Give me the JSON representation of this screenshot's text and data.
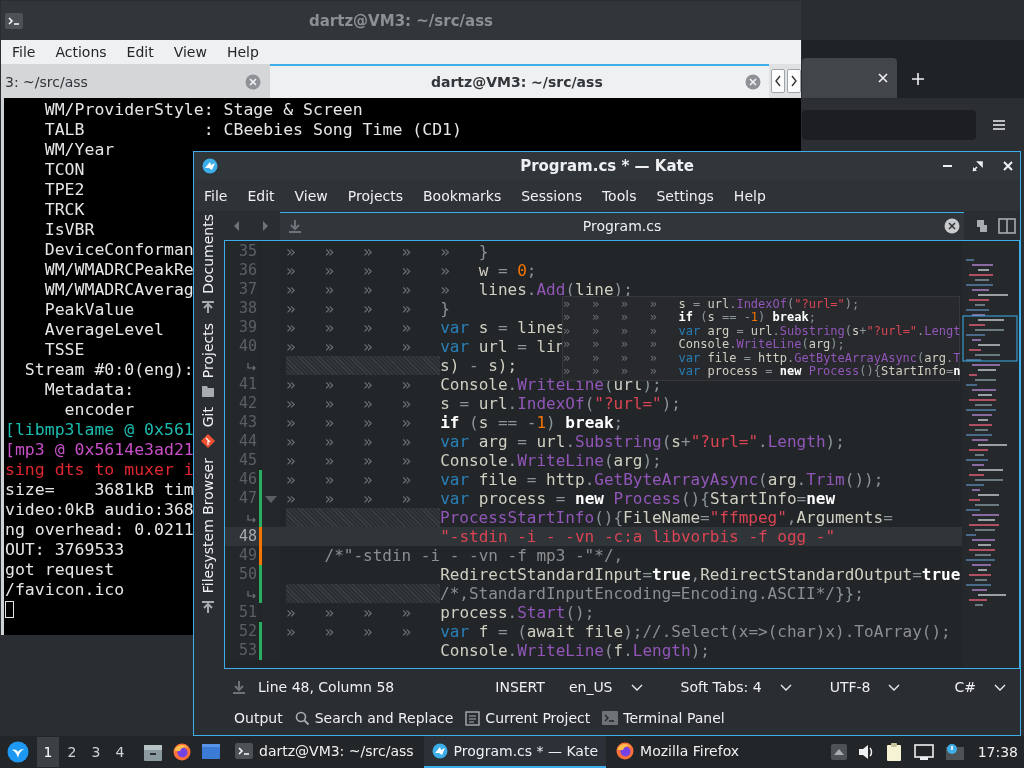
{
  "terminal_window": {
    "title": "dartz@VM3: ~/src/ass",
    "menu": [
      "File",
      "Actions",
      "Edit",
      "View",
      "Help"
    ],
    "tabs": [
      {
        "label": "3: ~/src/ass",
        "selected": false
      },
      {
        "label": "dartz@VM3: ~/src/ass",
        "selected": true
      }
    ],
    "lines": [
      {
        "text": "    WM/ProviderStyle: Stage & Screen",
        "color": "#e6e6e6"
      },
      {
        "text": "    TALB            : CBeebies Song Time (CD1)",
        "color": "#e6e6e6"
      },
      {
        "text": "    WM/Year",
        "color": "#e6e6e6"
      },
      {
        "text": "    TCON",
        "color": "#e6e6e6"
      },
      {
        "text": "    TPE2",
        "color": "#e6e6e6"
      },
      {
        "text": "    TRCK",
        "color": "#e6e6e6"
      },
      {
        "text": "    IsVBR",
        "color": "#e6e6e6"
      },
      {
        "text": "    DeviceConforman",
        "color": "#e6e6e6"
      },
      {
        "text": "    WM/WMADRCPeakRe",
        "color": "#e6e6e6"
      },
      {
        "text": "    WM/WMADRCAverag",
        "color": "#e6e6e6"
      },
      {
        "text": "    PeakValue",
        "color": "#e6e6e6"
      },
      {
        "text": "    AverageLevel",
        "color": "#e6e6e6"
      },
      {
        "text": "    TSSE",
        "color": "#e6e6e6"
      },
      {
        "text": "  Stream #0:0(eng):",
        "color": "#e6e6e6"
      },
      {
        "text": "    Metadata:",
        "color": "#e6e6e6"
      },
      {
        "text": "      encoder",
        "color": "#e6e6e6"
      },
      {
        "text": "[libmp3lame @ 0x561",
        "color": "#1abcb0"
      },
      {
        "text": "[mp3 @ 0x5614e3ad21",
        "color": "#c94fc9"
      },
      {
        "text": "sing dts to muxer i",
        "color": "#e0262f"
      },
      {
        "text": "size=    3681kB tim",
        "color": "#e6e6e6"
      },
      {
        "text": "video:0kB audio:368",
        "color": "#e6e6e6"
      },
      {
        "text": "ng overhead: 0.0211",
        "color": "#e6e6e6"
      },
      {
        "text": "OUT: 3769533",
        "color": "#e6e6e6"
      },
      {
        "text": "got request",
        "color": "#e6e6e6"
      },
      {
        "text": "/favicon.ico",
        "color": "#e6e6e6"
      }
    ],
    "cursor": true
  },
  "editor_window": {
    "title": "Program.cs * — Kate",
    "menu": [
      "File",
      "Edit",
      "View",
      "Projects",
      "Bookmarks",
      "Sessions",
      "Tools",
      "Settings",
      "Help"
    ],
    "sidebar_tabs": [
      "Documents",
      "Projects",
      "Git",
      "Filesystem Browser"
    ],
    "document_tab": {
      "label": "Program.cs"
    },
    "code_lines": [
      {
        "kind": "line",
        "number": "35",
        "current": false,
        "fold": false,
        "tokens": [
          {
            "kind": "indent",
            "text": "»»»»»"
          },
          {
            "kind": "op",
            "text": "}"
          }
        ]
      },
      {
        "kind": "line",
        "number": "36",
        "current": false,
        "fold": false,
        "tokens": [
          {
            "kind": "indent",
            "text": "»»»»»"
          },
          {
            "kind": "plain",
            "text": "w "
          },
          {
            "kind": "op",
            "text": "= "
          },
          {
            "kind": "num",
            "text": "0"
          },
          {
            "kind": "op",
            "text": ";"
          }
        ]
      },
      {
        "kind": "line",
        "number": "37",
        "current": false,
        "fold": false,
        "tokens": [
          {
            "kind": "indent",
            "text": "»»»»»"
          },
          {
            "kind": "plain",
            "text": "lines"
          },
          {
            "kind": "op",
            "text": "."
          },
          {
            "kind": "fn",
            "text": "Add"
          },
          {
            "kind": "op",
            "text": "("
          },
          {
            "kind": "plain",
            "text": "line"
          },
          {
            "kind": "op",
            "text": ");"
          }
        ]
      },
      {
        "kind": "line",
        "number": "38",
        "current": false,
        "fold": false,
        "tokens": [
          {
            "kind": "indent",
            "text": "»»»»"
          },
          {
            "kind": "op",
            "text": "}"
          }
        ]
      },
      {
        "kind": "line",
        "number": "39",
        "current": false,
        "fold": false,
        "tokens": [
          {
            "kind": "indent",
            "text": "»»»»"
          },
          {
            "kind": "kw",
            "text": "var"
          },
          {
            "kind": "plain",
            "text": " s "
          },
          {
            "kind": "op",
            "text": "= "
          },
          {
            "kind": "plain",
            "text": "lines"
          }
        ]
      },
      {
        "kind": "line",
        "number": "40",
        "current": false,
        "fold": false,
        "tokens": [
          {
            "kind": "indent",
            "text": "»»»»"
          },
          {
            "kind": "kw",
            "text": "var"
          },
          {
            "kind": "plain",
            "text": " url "
          },
          {
            "kind": "op",
            "text": "= "
          },
          {
            "kind": "plain",
            "text": "lin"
          }
        ]
      },
      {
        "kind": "wrap",
        "current": false,
        "fold": false,
        "tokens": [
          {
            "kind": "plain",
            "text": "s) "
          },
          {
            "kind": "op",
            "text": "- "
          },
          {
            "kind": "plain",
            "text": "s);"
          }
        ]
      },
      {
        "kind": "line",
        "number": "41",
        "current": false,
        "fold": false,
        "tokens": [
          {
            "kind": "indent",
            "text": "»»»»"
          },
          {
            "kind": "plain",
            "text": "Console"
          },
          {
            "kind": "op",
            "text": "."
          },
          {
            "kind": "fn",
            "text": "WriteLine"
          },
          {
            "kind": "op",
            "text": "("
          },
          {
            "kind": "plain",
            "text": "url"
          },
          {
            "kind": "op",
            "text": ");"
          }
        ]
      },
      {
        "kind": "line",
        "number": "42",
        "current": false,
        "fold": false,
        "tokens": [
          {
            "kind": "indent",
            "text": "»»»»"
          },
          {
            "kind": "plain",
            "text": "s "
          },
          {
            "kind": "op",
            "text": "= "
          },
          {
            "kind": "plain",
            "text": "url"
          },
          {
            "kind": "op",
            "text": "."
          },
          {
            "kind": "fn",
            "text": "IndexOf"
          },
          {
            "kind": "op",
            "text": "("
          },
          {
            "kind": "str",
            "text": "\"?url=\""
          },
          {
            "kind": "op",
            "text": ");"
          }
        ]
      },
      {
        "kind": "line",
        "number": "43",
        "current": false,
        "fold": false,
        "tokens": [
          {
            "kind": "indent",
            "text": "»»»»"
          },
          {
            "kind": "ctl",
            "text": "if"
          },
          {
            "kind": "op",
            "text": " ("
          },
          {
            "kind": "plain",
            "text": "s "
          },
          {
            "kind": "op",
            "text": "== -"
          },
          {
            "kind": "num",
            "text": "1"
          },
          {
            "kind": "op",
            "text": ") "
          },
          {
            "kind": "ctl",
            "text": "break"
          },
          {
            "kind": "op",
            "text": ";"
          }
        ]
      },
      {
        "kind": "line",
        "number": "44",
        "current": false,
        "fold": false,
        "tokens": [
          {
            "kind": "indent",
            "text": "»»»»"
          },
          {
            "kind": "kw",
            "text": "var"
          },
          {
            "kind": "plain",
            "text": " arg "
          },
          {
            "kind": "op",
            "text": "= "
          },
          {
            "kind": "plain",
            "text": "url"
          },
          {
            "kind": "op",
            "text": "."
          },
          {
            "kind": "fn",
            "text": "Substring"
          },
          {
            "kind": "op",
            "text": "("
          },
          {
            "kind": "plain",
            "text": "s"
          },
          {
            "kind": "op",
            "text": "+"
          },
          {
            "kind": "str",
            "text": "\"?url=\""
          },
          {
            "kind": "op",
            "text": "."
          },
          {
            "kind": "fn",
            "text": "Length"
          },
          {
            "kind": "op",
            "text": ");"
          }
        ]
      },
      {
        "kind": "line",
        "number": "45",
        "current": false,
        "fold": false,
        "tokens": [
          {
            "kind": "indent",
            "text": "»»»»"
          },
          {
            "kind": "plain",
            "text": "Console"
          },
          {
            "kind": "op",
            "text": "."
          },
          {
            "kind": "fn",
            "text": "WriteLine"
          },
          {
            "kind": "op",
            "text": "("
          },
          {
            "kind": "plain",
            "text": "arg"
          },
          {
            "kind": "op",
            "text": ");"
          }
        ]
      },
      {
        "kind": "line",
        "number": "46",
        "current": false,
        "fold": false,
        "color": "#27ae60",
        "tokens": [
          {
            "kind": "indent",
            "text": "»»»»"
          },
          {
            "kind": "kw",
            "text": "var"
          },
          {
            "kind": "plain",
            "text": " file "
          },
          {
            "kind": "op",
            "text": "= "
          },
          {
            "kind": "plain",
            "text": "http"
          },
          {
            "kind": "op",
            "text": "."
          },
          {
            "kind": "fn",
            "text": "GetByteArrayAsync"
          },
          {
            "kind": "op",
            "text": "("
          },
          {
            "kind": "plain",
            "text": "arg"
          },
          {
            "kind": "op",
            "text": "."
          },
          {
            "kind": "fn",
            "text": "Trim"
          },
          {
            "kind": "op",
            "text": "());"
          }
        ]
      },
      {
        "kind": "line",
        "number": "47",
        "current": false,
        "fold": true,
        "color": "#27ae60",
        "tokens": [
          {
            "kind": "indent",
            "text": "»»»»"
          },
          {
            "kind": "kw",
            "text": "var"
          },
          {
            "kind": "plain",
            "text": " process "
          },
          {
            "kind": "op",
            "text": "= "
          },
          {
            "kind": "ctl",
            "text": "new "
          },
          {
            "kind": "fn",
            "text": "Process"
          },
          {
            "kind": "op",
            "text": "(){"
          },
          {
            "kind": "plain",
            "text": "StartInfo"
          },
          {
            "kind": "op",
            "text": "="
          },
          {
            "kind": "ctl",
            "text": "new"
          }
        ]
      },
      {
        "kind": "wrap",
        "current": false,
        "fold": false,
        "color": "#27ae60",
        "tokens": [
          {
            "kind": "fn",
            "text": "ProcessStartInfo"
          },
          {
            "kind": "op",
            "text": "(){"
          },
          {
            "kind": "plain",
            "text": "FileName"
          },
          {
            "kind": "op",
            "text": "="
          },
          {
            "kind": "str",
            "text": "\"ffmpeg\""
          },
          {
            "kind": "op",
            "text": ","
          },
          {
            "kind": "plain",
            "text": "Arguments"
          },
          {
            "kind": "op",
            "text": "="
          }
        ]
      },
      {
        "kind": "line",
        "number": "48",
        "current": true,
        "fold": false,
        "color": "#f67400",
        "tokens": [
          {
            "kind": "str",
            "text": "                \"-stdin -i - -vn -c:a libvorbis -f ogg -\""
          }
        ]
      },
      {
        "kind": "line",
        "number": "49",
        "current": false,
        "fold": false,
        "color": "#f67400",
        "tokens": [
          {
            "kind": "cmt",
            "text": "    /*\"-stdin -i - -vn -f mp3 -\"*/,"
          }
        ]
      },
      {
        "kind": "line",
        "number": "50",
        "current": false,
        "fold": false,
        "color": "#27ae60",
        "tokens": [
          {
            "kind": "plain",
            "text": "                RedirectStandardInput"
          },
          {
            "kind": "op",
            "text": "="
          },
          {
            "kind": "ctl",
            "text": "true"
          },
          {
            "kind": "op",
            "text": ","
          },
          {
            "kind": "plain",
            "text": "RedirectStandardOutput"
          },
          {
            "kind": "op",
            "text": "="
          },
          {
            "kind": "ctl",
            "text": "true"
          }
        ]
      },
      {
        "kind": "wrap",
        "current": false,
        "fold": false,
        "color": "#27ae60",
        "tokens": [
          {
            "kind": "cmt",
            "text": "/*,StandardInputEncoding=Encoding.ASCII*/"
          },
          {
            "kind": "op",
            "text": "}};"
          }
        ]
      },
      {
        "kind": "line",
        "number": "51",
        "current": false,
        "fold": false,
        "tokens": [
          {
            "kind": "indent",
            "text": "»»»»"
          },
          {
            "kind": "plain",
            "text": "process"
          },
          {
            "kind": "op",
            "text": "."
          },
          {
            "kind": "fn",
            "text": "Start"
          },
          {
            "kind": "op",
            "text": "();"
          }
        ]
      },
      {
        "kind": "line",
        "number": "52",
        "current": false,
        "fold": false,
        "color": "#27ae60",
        "tokens": [
          {
            "kind": "indent",
            "text": "»»»»"
          },
          {
            "kind": "kw",
            "text": "var"
          },
          {
            "kind": "plain",
            "text": " f "
          },
          {
            "kind": "op",
            "text": "= ("
          },
          {
            "kind": "plain",
            "text": "await file"
          },
          {
            "kind": "op",
            "text": ");"
          },
          {
            "kind": "cmt",
            "text": "//.Select(x=>(char)x).ToArray();"
          }
        ]
      },
      {
        "kind": "line",
        "number": "53",
        "current": false,
        "fold": false,
        "color": "#27ae60",
        "tokens": [
          {
            "kind": "plain",
            "text": "                Console"
          },
          {
            "kind": "op",
            "text": "."
          },
          {
            "kind": "fn",
            "text": "WriteLine"
          },
          {
            "kind": "op",
            "text": "("
          },
          {
            "kind": "plain",
            "text": "f"
          },
          {
            "kind": "op",
            "text": "."
          },
          {
            "kind": "fn",
            "text": "Length"
          },
          {
            "kind": "op",
            "text": ");"
          }
        ]
      }
    ],
    "scroll_preview": [
      {
        "tokens": [
          {
            "kind": "indent",
            "text": "»»»»"
          },
          {
            "kind": "plain",
            "text": "s "
          },
          {
            "kind": "op",
            "text": "= "
          },
          {
            "kind": "plain",
            "text": "url"
          },
          {
            "kind": "op",
            "text": "."
          },
          {
            "kind": "fn",
            "text": "IndexOf"
          },
          {
            "kind": "op",
            "text": "("
          },
          {
            "kind": "str",
            "text": "\"?url=\""
          },
          {
            "kind": "op",
            "text": ");"
          }
        ]
      },
      {
        "tokens": [
          {
            "kind": "indent",
            "text": "»»»»"
          },
          {
            "kind": "ctl",
            "text": "if"
          },
          {
            "kind": "op",
            "text": " ("
          },
          {
            "kind": "plain",
            "text": "s "
          },
          {
            "kind": "op",
            "text": "== -"
          },
          {
            "kind": "num",
            "text": "1"
          },
          {
            "kind": "op",
            "text": ") "
          },
          {
            "kind": "ctl",
            "text": "break"
          },
          {
            "kind": "op",
            "text": ";"
          }
        ]
      },
      {
        "tokens": [
          {
            "kind": "indent",
            "text": "»»»»"
          },
          {
            "kind": "kw",
            "text": "var"
          },
          {
            "kind": "plain",
            "text": " arg "
          },
          {
            "kind": "op",
            "text": "= "
          },
          {
            "kind": "plain",
            "text": "url"
          },
          {
            "kind": "op",
            "text": "."
          },
          {
            "kind": "fn",
            "text": "Substring"
          },
          {
            "kind": "op",
            "text": "("
          },
          {
            "kind": "plain",
            "text": "s"
          },
          {
            "kind": "op",
            "text": "+"
          },
          {
            "kind": "str",
            "text": "\"?url=\""
          },
          {
            "kind": "op",
            "text": "."
          },
          {
            "kind": "fn",
            "text": "Lengt"
          }
        ]
      },
      {
        "tokens": [
          {
            "kind": "indent",
            "text": "»»»»"
          },
          {
            "kind": "plain",
            "text": "Console"
          },
          {
            "kind": "op",
            "text": "."
          },
          {
            "kind": "fn",
            "text": "WriteLine"
          },
          {
            "kind": "op",
            "text": "("
          },
          {
            "kind": "plain",
            "text": "arg"
          },
          {
            "kind": "op",
            "text": ");"
          }
        ]
      },
      {
        "tokens": [
          {
            "kind": "indent",
            "text": "»»»»"
          },
          {
            "kind": "kw",
            "text": "var"
          },
          {
            "kind": "plain",
            "text": " file "
          },
          {
            "kind": "op",
            "text": "= "
          },
          {
            "kind": "plain",
            "text": "http"
          },
          {
            "kind": "op",
            "text": "."
          },
          {
            "kind": "fn",
            "text": "GetByteArrayAsync"
          },
          {
            "kind": "op",
            "text": "("
          },
          {
            "kind": "plain",
            "text": "arg"
          },
          {
            "kind": "op",
            "text": "."
          },
          {
            "kind": "fn",
            "text": "T"
          }
        ]
      },
      {
        "tokens": [
          {
            "kind": "indent",
            "text": "»»»»"
          },
          {
            "kind": "kw",
            "text": "var"
          },
          {
            "kind": "plain",
            "text": " process "
          },
          {
            "kind": "op",
            "text": "= "
          },
          {
            "kind": "ctl",
            "text": "new "
          },
          {
            "kind": "fn",
            "text": "Process"
          },
          {
            "kind": "op",
            "text": "(){"
          },
          {
            "kind": "plain",
            "text": "StartInfo"
          },
          {
            "kind": "op",
            "text": "="
          },
          {
            "kind": "ctl",
            "text": "n"
          }
        ]
      }
    ],
    "status_bar": {
      "position": "Line 48, Column 58",
      "mode": "INSERT",
      "dropdowns": [
        "en_US",
        "Soft Tabs: 4",
        "UTF-8",
        "C#"
      ]
    },
    "tool_views": [
      "Output",
      "Search and Replace",
      "Current Project",
      "Terminal Panel"
    ]
  },
  "taskbar": {
    "desktops": [
      {
        "label": "1",
        "selected": true
      },
      {
        "label": "2",
        "selected": false
      },
      {
        "label": "3",
        "selected": false
      },
      {
        "label": "4",
        "selected": false
      }
    ],
    "tasks": [
      {
        "label": "dartz@VM3: ~/src/ass",
        "selected": false
      },
      {
        "label": "Program.cs * — Kate",
        "selected": true
      },
      {
        "label": "Mozilla Firefox",
        "selected": false
      }
    ],
    "clock": "17:38"
  }
}
